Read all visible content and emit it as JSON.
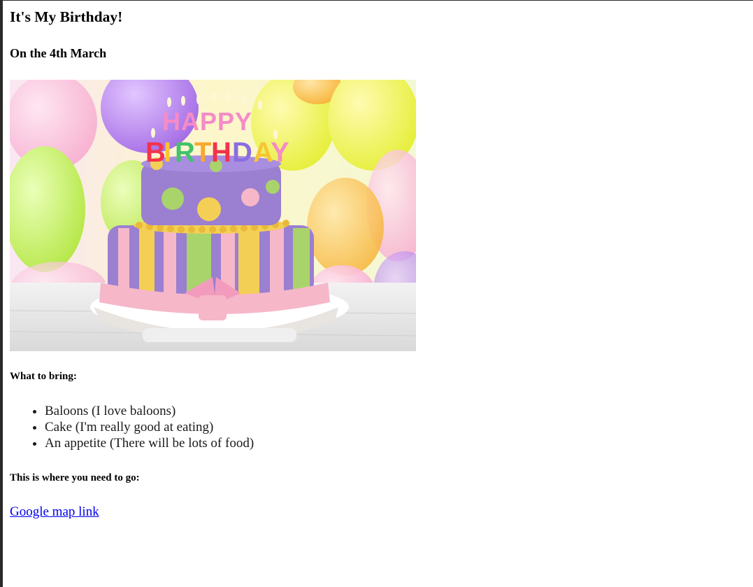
{
  "page": {
    "title": "It's My Birthday!",
    "date": "On the 4th March",
    "bring_heading": "What to bring:",
    "bring_items": [
      "Baloons (I love baloons)",
      "Cake (I'm really good at eating)",
      "An appetite (There will be lots of food)"
    ],
    "where_heading": "This is where you need to go:",
    "map_link_text": "Google map link"
  },
  "image": {
    "description_icon": "birthday-cake-photo",
    "lettering": "HAPPY BIRTHDAY"
  },
  "colors": {
    "link": "#0000ee",
    "frame": "#2a2a2a",
    "cake_purple": "#9b7fd0",
    "cake_pink": "#f6b7c9",
    "cake_yellow": "#f4cf55",
    "cake_green": "#a9d46b"
  }
}
